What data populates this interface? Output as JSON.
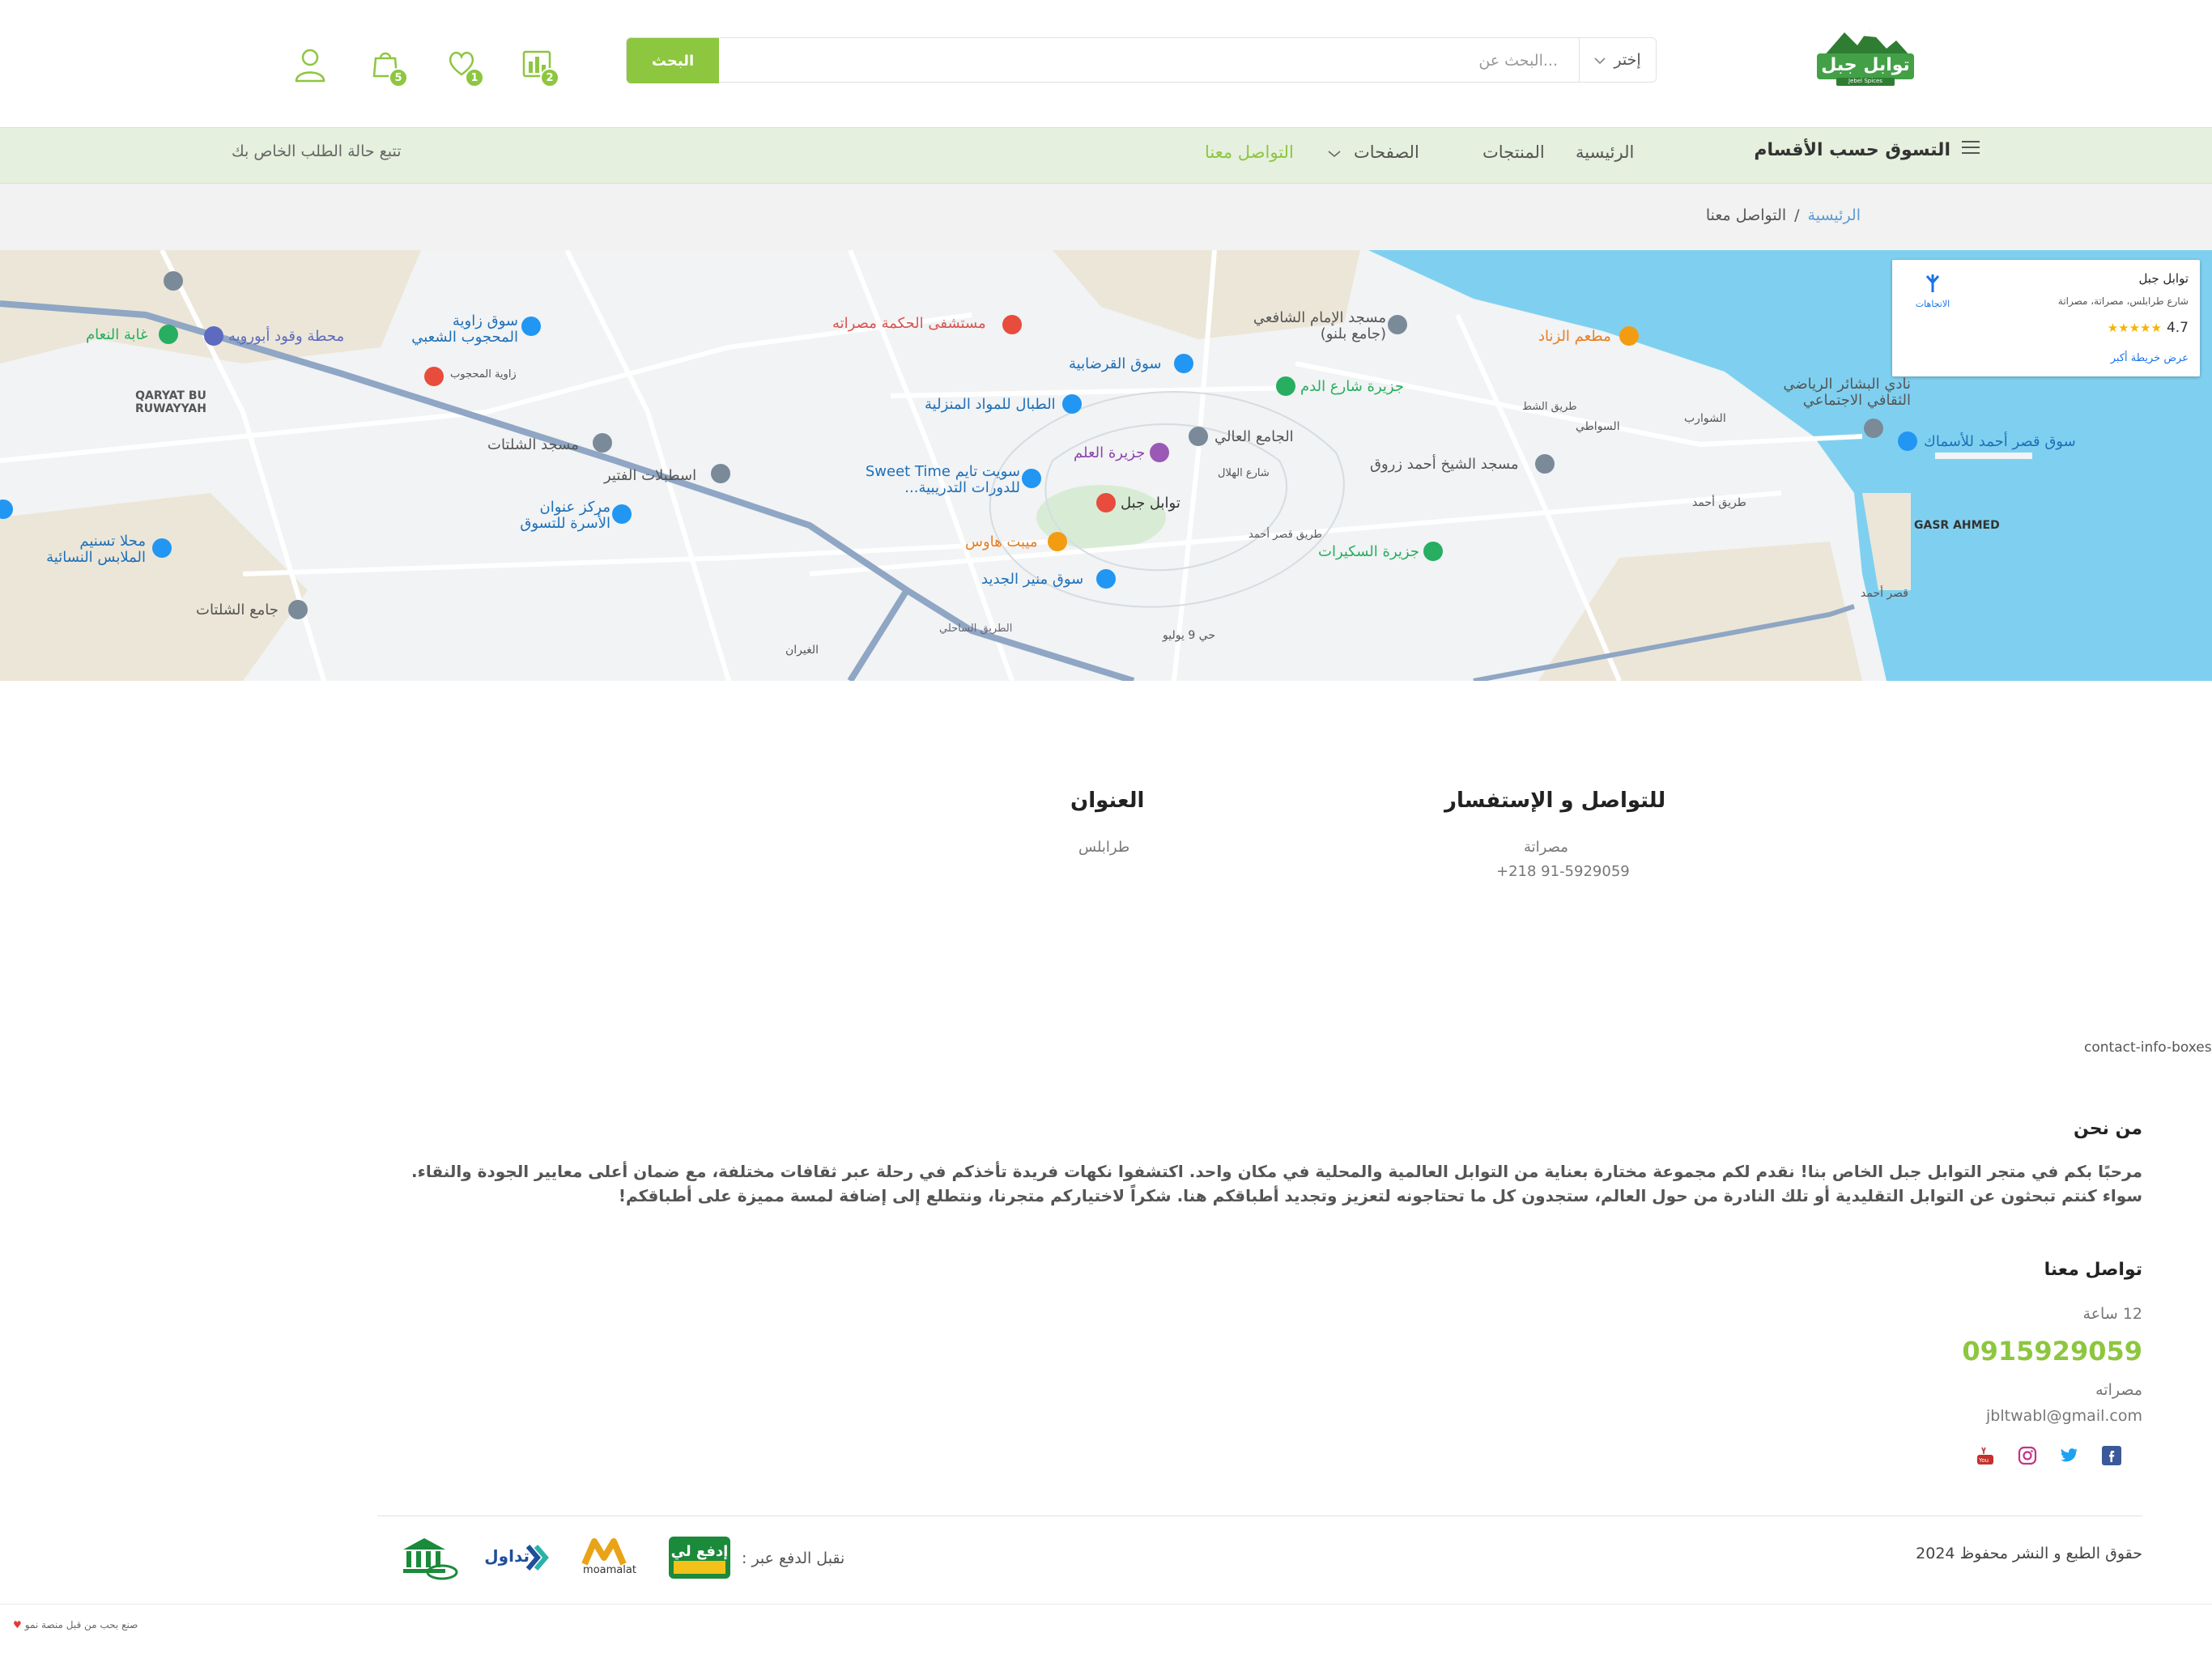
{
  "header": {
    "logo_text": "توابل جبل",
    "logo_sub": "Jebel Spices",
    "search_button": "البحث",
    "search_placeholder": "البحث عن...",
    "category_select": "إختر",
    "compare_count": "2",
    "wishlist_count": "1",
    "cart_count": "5"
  },
  "nav": {
    "shop_by_category": "التسوق حسب الأقسام",
    "items": [
      "الرئيسية",
      "المنتجات",
      "الصفحات",
      "التواصل معنا"
    ],
    "track_order": "تتبع حالة الطلب الخاص بك"
  },
  "breadcrumb": {
    "home": "الرئيسية",
    "separator": "/",
    "current": "التواصل معنا"
  },
  "map": {
    "card": {
      "place_name": "توابل جبل",
      "address": "شارع طرابلس، مصراتة، مصراتة",
      "rating": "4.7",
      "stars": "★★★★★",
      "directions": "الاتجاهات",
      "view_larger": "عرض خريطة أكبر"
    },
    "labels": [
      "مستشفى الحكمة مصراته",
      "مسجد الإمام الشافعي (جامع بلنو)",
      "مطعم الزناد",
      "سوق القرضابية",
      "جزيرة شارع الدم",
      "الطبال للمواد المنزلية",
      "الجامع العالي",
      "سوق زاوية المحجوب الشعبي",
      "محطة وقود أبورويه",
      "غابة النعام",
      "مسجد الشلتات",
      "اسطبلات الفتير",
      "مركز عنوان الأسرة للتسوق",
      "محلا تسنيم الملابس النسائية",
      "جامع الشلتات",
      "جزيرة العلم",
      "سويت تايم Sweet Time للدورات التدريبية...",
      "توابل جبل",
      "ميبت هاوس",
      "سوق منير الجديد",
      "جزيرة السكيرات",
      "مسجد الشيخ أحمد زروق",
      "نادي البشائر الرياضي الثقافي الاجتماعي",
      "سوق قصر أحمد للأسماك",
      "QARYAT BU RUWAYYAH",
      "GASR AHMED",
      "زاوية المحجوب",
      "السواطي",
      "الشوارب",
      "طريق أحمد",
      "حي 9 يوليو",
      "الغيران",
      "قصر أحمد",
      "الطريق الساحلي",
      "شارع الهلال",
      "طريق قصر أحمد",
      "طريق الشط"
    ]
  },
  "contact_info": {
    "inquiry_title": "للتواصل و الإستفسار",
    "inquiry_city": "مصراتة",
    "inquiry_phone": "+218 91-5929059",
    "address_title": "العنوان",
    "address_value": "طرابلس",
    "shortcode_text": "contact-info-boxes/]"
  },
  "footer": {
    "about_title": "من نحن",
    "about_text": "مرحبًا بكم في متجر التوابل جبل الخاص بنا! نقدم لكم مجموعة مختارة بعناية من التوابل العالمية والمحلية في مكان واحد. اكتشفوا نكهات فريدة تأخذكم في رحلة عبر ثقافات مختلفة، مع ضمان أعلى معايير الجودة والنقاء. سواء كنتم تبحثون عن التوابل التقليدية أو تلك النادرة من حول العالم، ستجدون كل ما تحتاجونه لتعزيز وتجديد أطباقكم هنا. شكراً لاختياركم متجرنا، ونتطلع إلى إضافة لمسة مميزة على أطباقكم!",
    "contact_title": "تواصل معنا",
    "hours": "12 ساعة",
    "phone": "0915929059",
    "city": "مصراته",
    "email": "jbltwabl@gmail.com",
    "copyright": "حقوق الطبع و النشر محفوظ 2024",
    "payment_label": "نقبل الدفع عبر :",
    "payment_logos": [
      "إدفع لي",
      "moamalat",
      "تداول",
      "bank"
    ],
    "made_by": "صنع بحب من قبل منصة نمو"
  },
  "colors": {
    "brand_green": "#8dc63f",
    "nav_bg": "#e5f0de",
    "breadcrumb_bg": "#f2f2f2",
    "sea": "#7fd0f0",
    "link_blue": "#5b9bd5"
  }
}
